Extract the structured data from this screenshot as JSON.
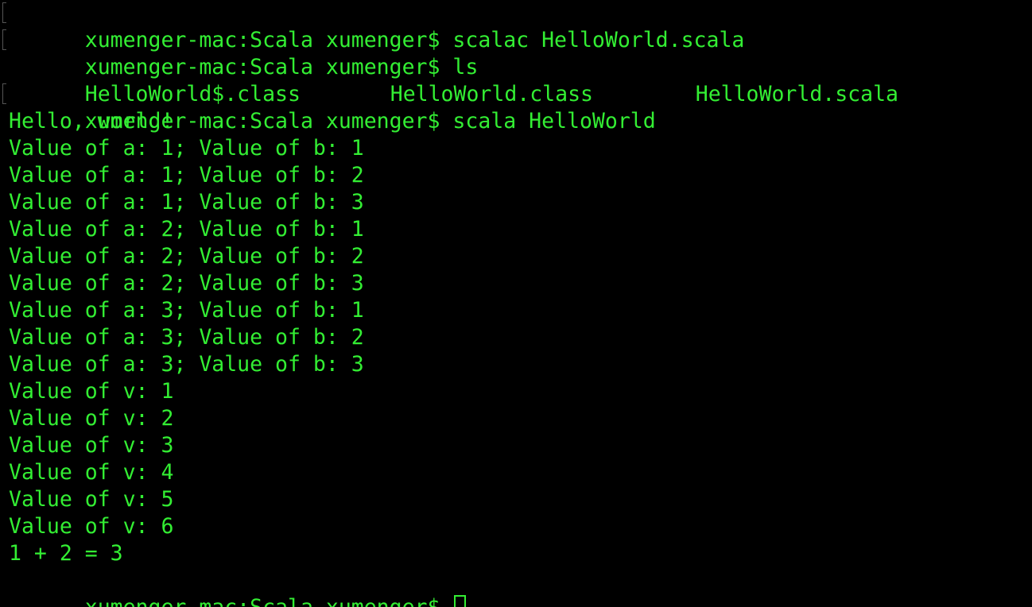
{
  "terminal": {
    "text_color": "#33ee33",
    "background_color": "#000000",
    "lines": [
      {
        "text": "xumenger-mac:Scala xumenger$ scalac HelloWorld.scala",
        "marked": true
      },
      {
        "text": "xumenger-mac:Scala xumenger$ ls",
        "marked": true
      }
    ],
    "ls_output": [
      "HelloWorld$.class",
      "HelloWorld.class",
      "HelloWorld.scala"
    ],
    "run_command": "xumenger-mac:Scala xumenger$ scala HelloWorld",
    "output": [
      "Hello, world!",
      "Value of a: 1; Value of b: 1",
      "Value of a: 1; Value of b: 2",
      "Value of a: 1; Value of b: 3",
      "Value of a: 2; Value of b: 1",
      "Value of a: 2; Value of b: 2",
      "Value of a: 2; Value of b: 3",
      "Value of a: 3; Value of b: 1",
      "Value of a: 3; Value of b: 2",
      "Value of a: 3; Value of b: 3",
      "Value of v: 1",
      "Value of v: 2",
      "Value of v: 3",
      "Value of v: 4",
      "Value of v: 5",
      "Value of v: 6",
      "1 + 2 = 3"
    ],
    "prompt": "xumenger-mac:Scala xumenger$ "
  }
}
